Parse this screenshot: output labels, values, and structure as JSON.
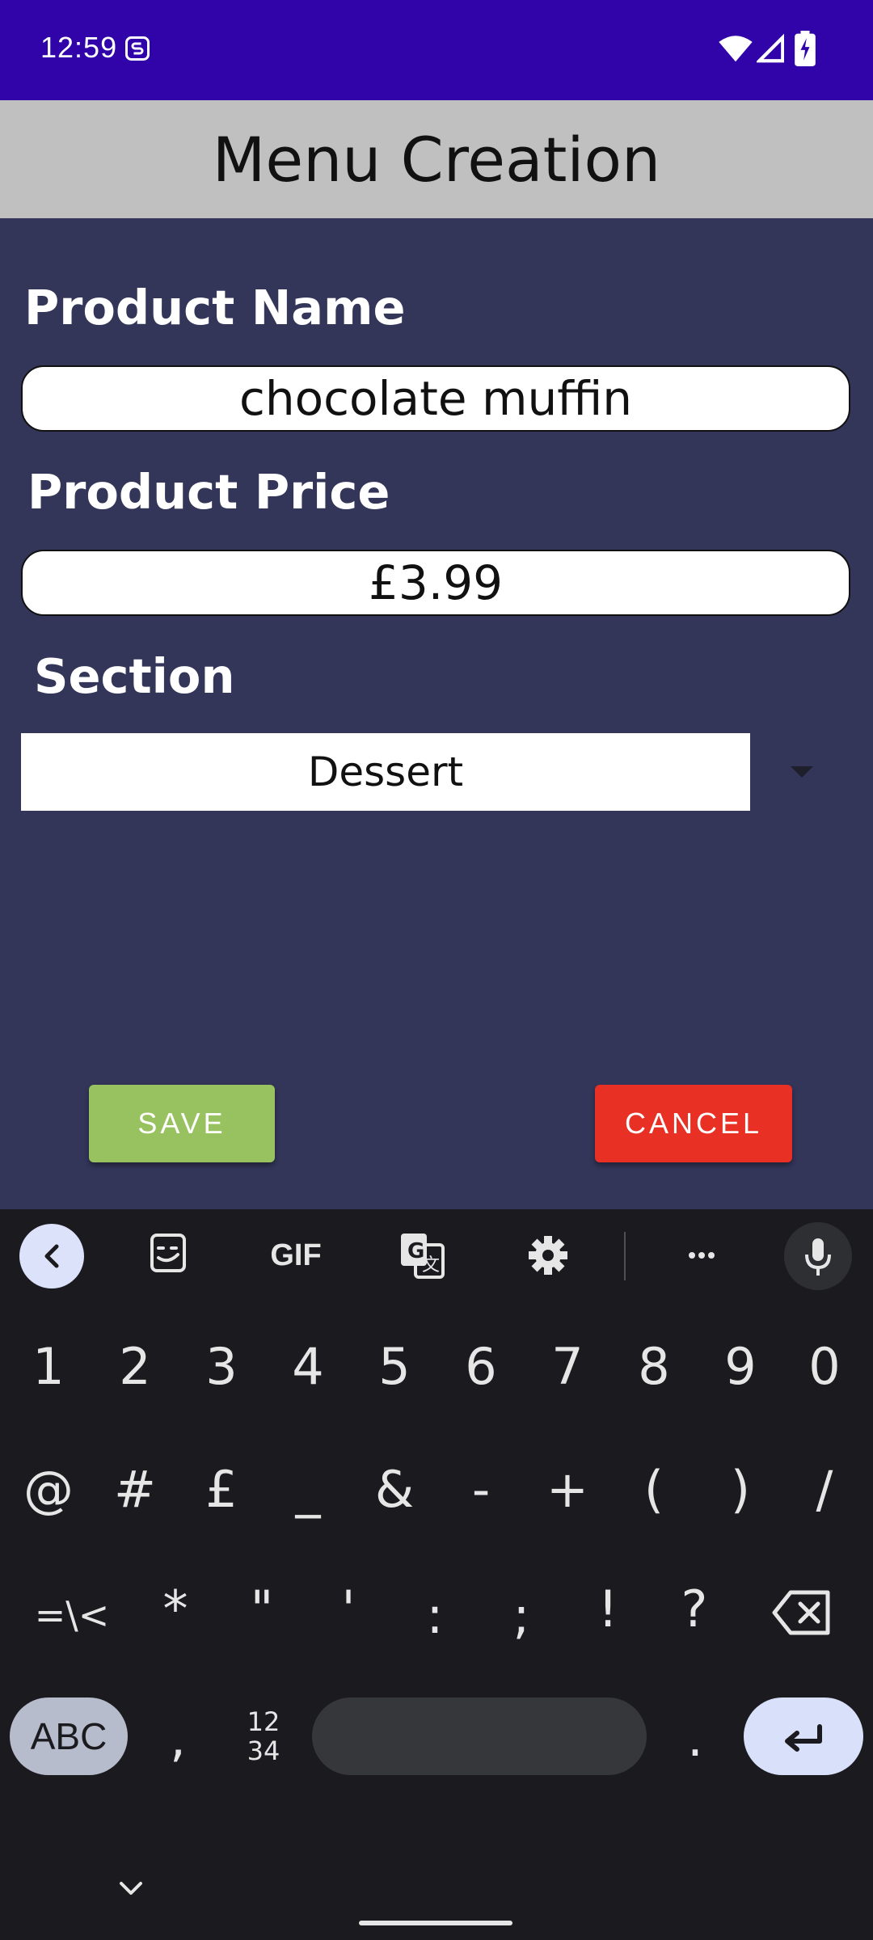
{
  "status_bar": {
    "time": "12:59",
    "color": "#3104aa"
  },
  "header": {
    "title": "Menu Creation",
    "background": "#c0c0c0"
  },
  "form": {
    "background": "#333559",
    "product_name_label": "Product Name",
    "product_name_value": "chocolate muffin",
    "product_price_label": "Product Price",
    "product_price_value": "£3.99",
    "section_label": "Section",
    "section_value": "Dessert",
    "save_label": "SAVE",
    "cancel_label": "CANCEL",
    "save_color": "#98c25f",
    "cancel_color": "#e83124"
  },
  "keyboard": {
    "toolbar": [
      "back-icon",
      "sticker-icon",
      "gif-icon",
      "translate-icon",
      "settings-icon",
      "more-icon",
      "mic-icon"
    ],
    "gif_label": "GIF",
    "row1": [
      "1",
      "2",
      "3",
      "4",
      "5",
      "6",
      "7",
      "8",
      "9",
      "0"
    ],
    "row2": [
      "@",
      "#",
      "£",
      "_",
      "&",
      "-",
      "+",
      "(",
      ")",
      "/"
    ],
    "row3": [
      "=\\<",
      "*",
      "\"",
      "'",
      ":",
      ";",
      "!",
      "?"
    ],
    "abc_label": "ABC",
    "comma": ",",
    "numgrid_label": "12\n34",
    "period": "."
  }
}
